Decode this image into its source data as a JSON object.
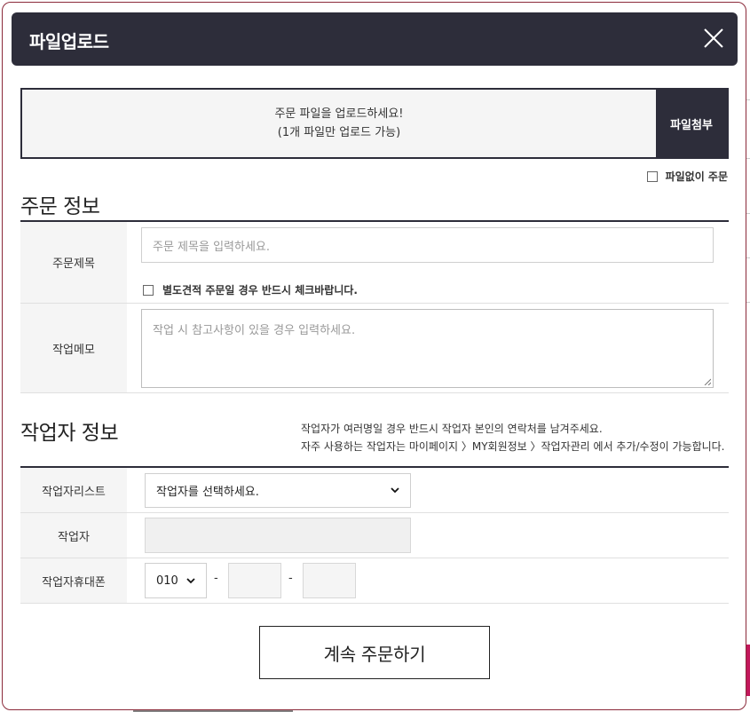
{
  "modal": {
    "title": "파일업로드",
    "close_icon": "close-icon"
  },
  "upload": {
    "line1": "주문 파일을 업로드하세요!",
    "line2": "(1개 파일만 업로드 가능)",
    "attach_label": "파일첨부",
    "no_file_label": "파일없이 주문"
  },
  "order_info": {
    "section_title": "주문 정보",
    "title_label": "주문제목",
    "title_placeholder": "주문 제목을 입력하세요.",
    "separate_quote_label": "별도견적 주문일 경우 반드시 체크바랍니다.",
    "memo_label": "작업메모",
    "memo_placeholder": "작업 시 참고사항이 있을 경우 입력하세요."
  },
  "worker_info": {
    "section_title": "작업자 정보",
    "note_line1": "작업자가 여러명일 경우 반드시 작업자 본인의 연락처를 남겨주세요.",
    "note_line2": "자주 사용하는 작업자는 마이페이지 〉MY회원정보 〉작업자관리 에서 추가/수정이 가능합니다.",
    "list_label": "작업자리스트",
    "list_selected": "작업자를 선택하세요.",
    "worker_label": "작업자",
    "phone_label": "작업자휴대폰",
    "phone_prefix": "010",
    "dash": "-"
  },
  "continue_label": "계속 주문하기"
}
